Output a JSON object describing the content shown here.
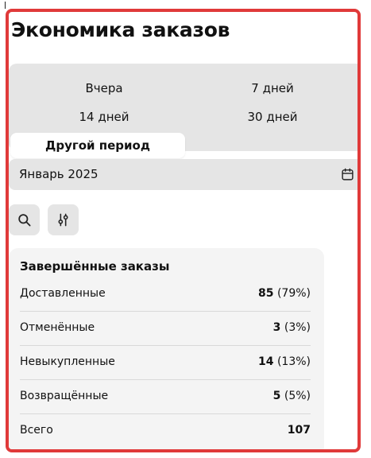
{
  "page": {
    "title": "Экономика заказов"
  },
  "periods": {
    "options": [
      {
        "label": "Вчера"
      },
      {
        "label": "7 дней"
      },
      {
        "label": "14 дней"
      },
      {
        "label": "30 дней"
      },
      {
        "label": "Другой период"
      }
    ],
    "selected": "Другой период"
  },
  "month_picker": {
    "label": "Январь 2025",
    "icon": "calendar-icon"
  },
  "tools": {
    "search_icon": "search-icon",
    "filter_icon": "sliders-icon"
  },
  "summary": {
    "title": "Завершённые заказы",
    "rows": [
      {
        "label": "Доставленные",
        "count": "85",
        "percent": "(79%)"
      },
      {
        "label": "Отменённые",
        "count": "3",
        "percent": "(3%)"
      },
      {
        "label": "Невыкупленные",
        "count": "14",
        "percent": "(13%)"
      },
      {
        "label": "Возвращённые",
        "count": "5",
        "percent": "(5%)"
      },
      {
        "label": "Всего",
        "count": "107",
        "percent": ""
      }
    ]
  },
  "colors": {
    "highlight_border": "#e03a3a",
    "control_bg": "#e5e5e5",
    "card_bg": "#f4f4f4"
  }
}
